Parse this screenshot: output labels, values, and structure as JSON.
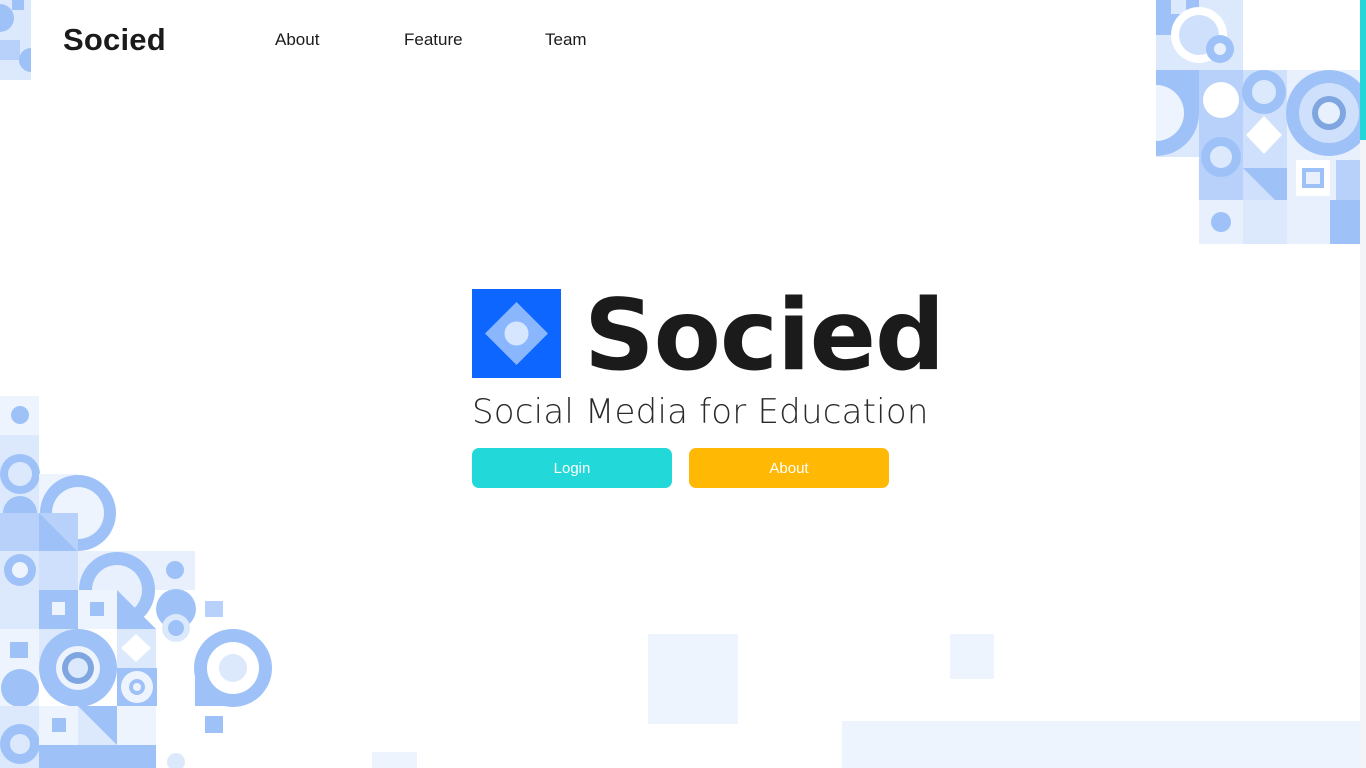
{
  "brand": {
    "name": "Socied"
  },
  "nav": {
    "items": [
      {
        "label": "About"
      },
      {
        "label": "Feature"
      },
      {
        "label": "Team"
      }
    ]
  },
  "hero": {
    "title": "Socied",
    "subtitle": "Social Media for Education",
    "buttons": {
      "login_label": "Login",
      "about_label": "About"
    }
  },
  "colors": {
    "logo_blue": "#0d66ff",
    "login_button": "#22d8d8",
    "about_button": "#ffb905",
    "pattern_blue": "#9ec2f8",
    "pattern_light": "#dce9fd",
    "scrollbar": "#25d6d8"
  },
  "icons": {
    "logo": "diamond-logo-icon",
    "decoration": "geometric-pattern"
  }
}
